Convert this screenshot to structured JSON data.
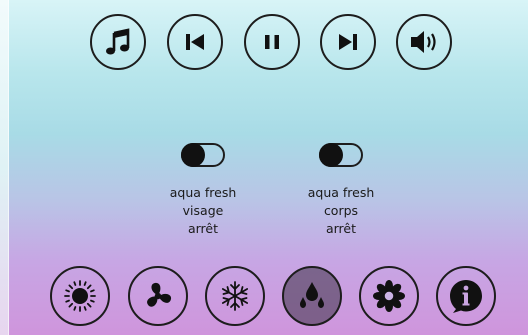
{
  "top_controls": [
    {
      "name": "music-button",
      "icon": "music-note-icon"
    },
    {
      "name": "previous-button",
      "icon": "skip-back-icon"
    },
    {
      "name": "pause-button",
      "icon": "pause-icon"
    },
    {
      "name": "next-button",
      "icon": "skip-forward-icon"
    },
    {
      "name": "volume-button",
      "icon": "speaker-volume-icon"
    }
  ],
  "toggles": [
    {
      "line1": "aqua fresh",
      "line2": "visage",
      "line3": "arrêt",
      "state": "off"
    },
    {
      "line1": "aqua fresh",
      "line2": "corps",
      "line3": "arrêt",
      "state": "off"
    }
  ],
  "bottom_controls": [
    {
      "name": "light-button",
      "icon": "sun-icon"
    },
    {
      "name": "fan-button",
      "icon": "fan-icon"
    },
    {
      "name": "cold-button",
      "icon": "snowflake-icon"
    },
    {
      "name": "water-button",
      "icon": "water-drops-icon",
      "active": true
    },
    {
      "name": "flower-button",
      "icon": "flower-icon"
    },
    {
      "name": "info-button",
      "icon": "info-icon"
    }
  ],
  "colors": {
    "stroke": "#1d1d1d",
    "active_fill": "#5c4f68",
    "gradient_top": "#d8f4f7",
    "gradient_bottom": "#cf95dc"
  }
}
